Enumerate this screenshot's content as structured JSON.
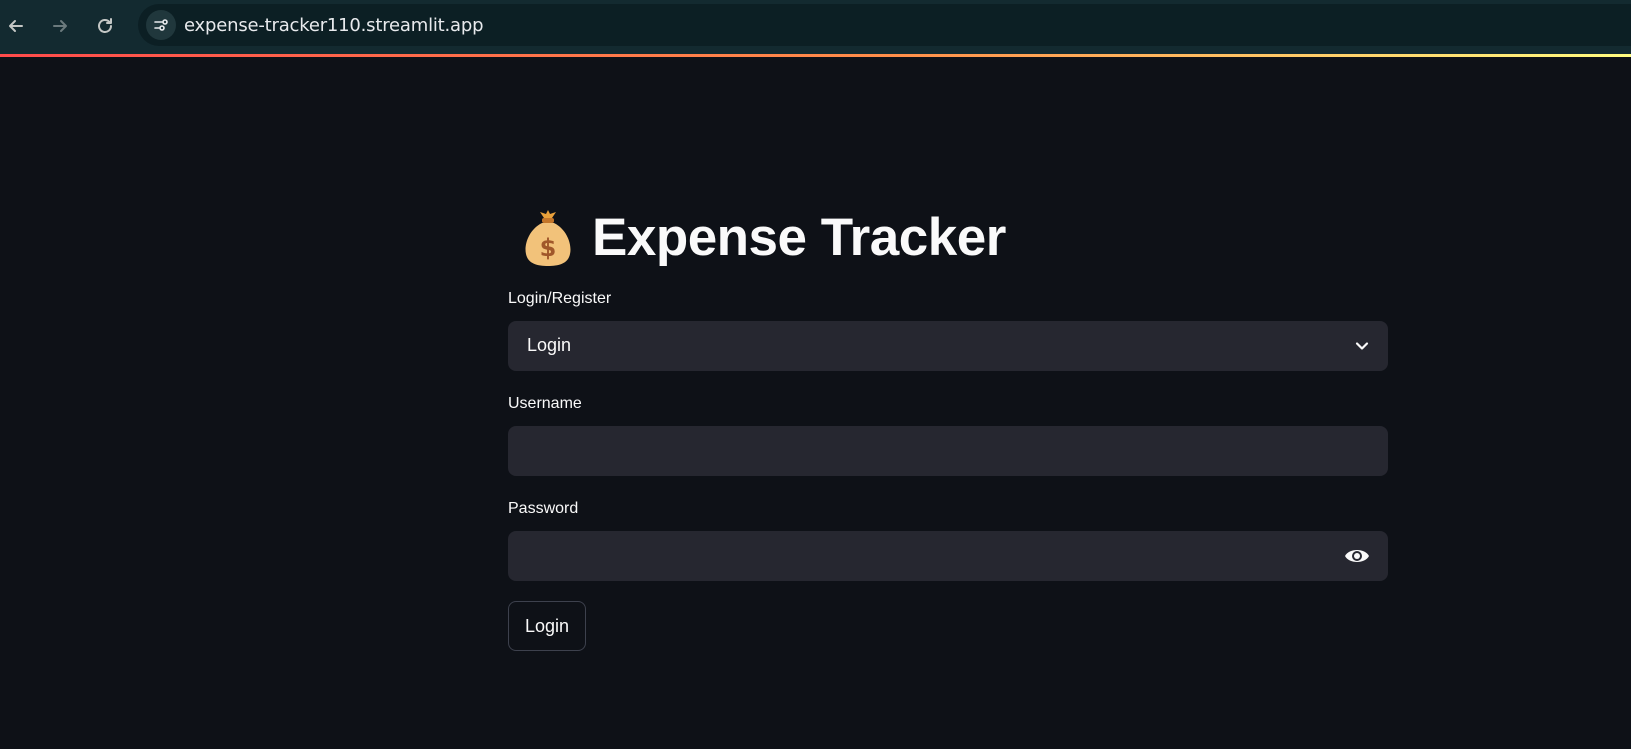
{
  "browser": {
    "url": "expense-tracker110.streamlit.app"
  },
  "app": {
    "title": "Expense Tracker",
    "title_icon": "money-bag-icon"
  },
  "form": {
    "mode_label": "Login/Register",
    "mode_value": "Login",
    "username_label": "Username",
    "username_value": "",
    "password_label": "Password",
    "password_value": "",
    "submit_label": "Login"
  },
  "colors": {
    "background": "#0e1117",
    "field_background": "#262730",
    "text": "#fafafa",
    "browser_bar": "#132a30"
  }
}
